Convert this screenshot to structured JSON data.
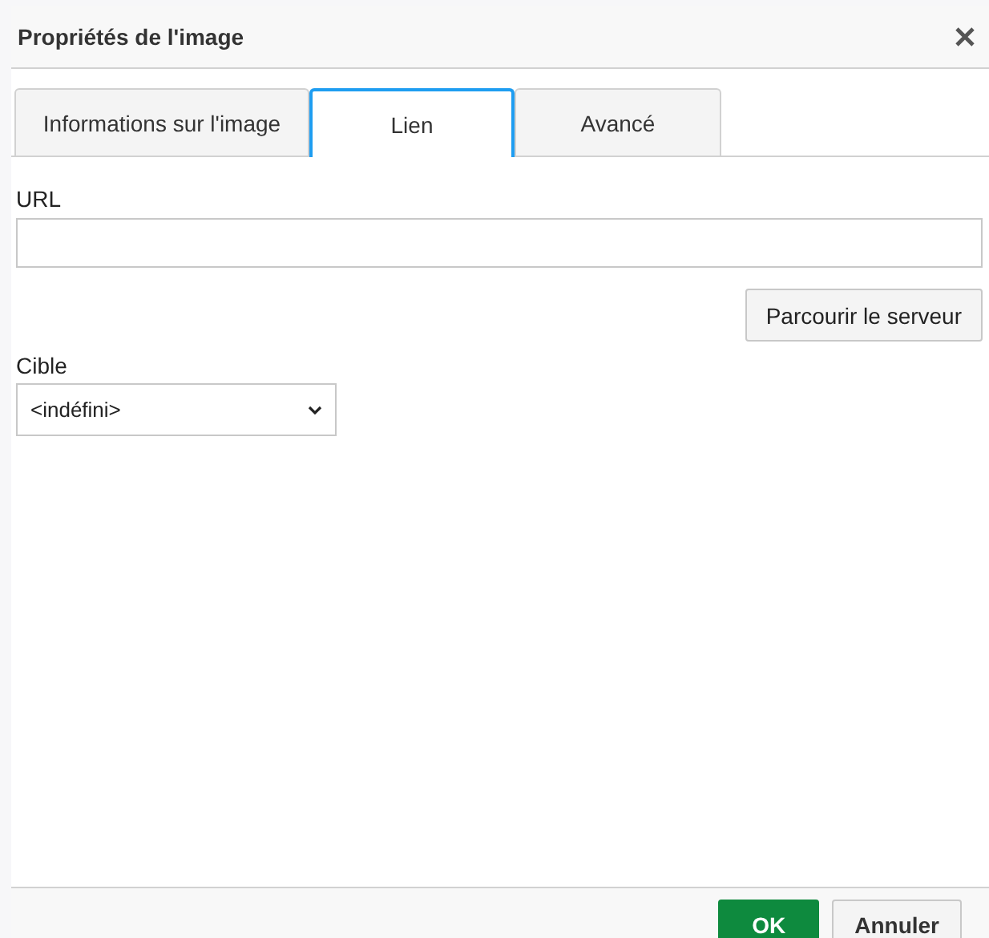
{
  "dialog": {
    "title": "Propriétés de l'image"
  },
  "tabs": [
    {
      "label": "Informations sur l'image",
      "selected": false
    },
    {
      "label": "Lien",
      "selected": true
    },
    {
      "label": "Avancé",
      "selected": false
    }
  ],
  "url_field": {
    "label": "URL"
  },
  "browse_button": "Parcourir le serveur",
  "target": {
    "label": "Cible",
    "value": "<indéfini>"
  },
  "buttons": [
    {
      "label": "OK",
      "kind": "primary"
    },
    {
      "label": "Annuler",
      "kind": "secondary"
    }
  ]
}
